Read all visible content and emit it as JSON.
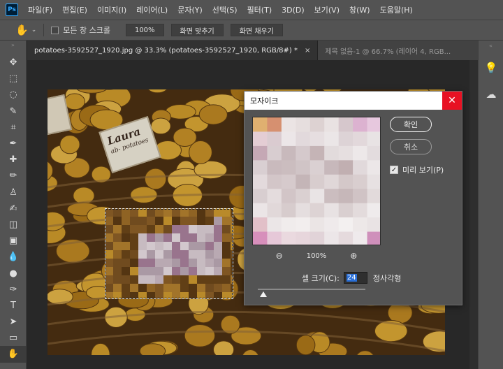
{
  "menubar": {
    "logo": "Ps",
    "items": [
      "파일(F)",
      "편집(E)",
      "이미지(I)",
      "레이어(L)",
      "문자(Y)",
      "선택(S)",
      "필터(T)",
      "3D(D)",
      "보기(V)",
      "창(W)",
      "도움말(H)"
    ]
  },
  "options": {
    "scroll_all_label": "모든 창 스크롤",
    "zoom_value": "100%",
    "fit_screen": "화면 맞추기",
    "fill_screen": "화면 채우기"
  },
  "tabs": [
    {
      "label": "potatoes-3592527_1920.jpg @ 33.3% (potatoes-3592527_1920, RGB/8#) *",
      "close": "×"
    },
    {
      "label": "제목 없음-1 @ 66.7% (레이어 4, RGB..."
    }
  ],
  "toolbar": {
    "icons": [
      "move-icon",
      "marquee-icon",
      "lasso-icon",
      "quick-select-icon",
      "crop-icon",
      "eyedropper-icon",
      "healing-icon",
      "brush-icon",
      "stamp-icon",
      "history-brush-icon",
      "eraser-icon",
      "gradient-icon",
      "blur-icon",
      "dodge-icon",
      "pen-icon",
      "type-icon",
      "path-select-icon",
      "shape-icon",
      "hand-icon"
    ],
    "glyphs": [
      "✥",
      "⬚",
      "◌",
      "✎",
      "⌗",
      "✒",
      "✚",
      "✏",
      "♙",
      "✍",
      "◫",
      "▣",
      "💧",
      "●",
      "✑",
      "T",
      "➤",
      "▭",
      "✋"
    ]
  },
  "canvas": {
    "tag_title": "Laura",
    "tag_sub": "ab- potatoes"
  },
  "dialog": {
    "title": "모자이크",
    "close": "✕",
    "ok": "확인",
    "cancel": "취소",
    "preview_label": "미리 보기(P)",
    "preview_checked": true,
    "zoom_level": "100%",
    "cell_label": "셀 크기(C):",
    "cell_value": "24",
    "cell_unit": "정사각형",
    "slider_fraction": 0.05,
    "preview_grid": [
      [
        "#e0b070",
        "#d69070",
        "#ebe4e4",
        "#e6dede",
        "#ddd2d2",
        "#e9e2e2",
        "#d6c7cc",
        "#dcb2d0",
        "#e7c8de"
      ],
      [
        "#e4cdd4",
        "#dacbd0",
        "#ece6e8",
        "#e2d9dc",
        "#e6dee0",
        "#ebe6e7",
        "#ddd3d6",
        "#e2d8db",
        "#e8e3e4"
      ],
      [
        "#c5a8b5",
        "#d8cdd0",
        "#c8b9bc",
        "#d5c9cc",
        "#c5b4b6",
        "#e2dbdc",
        "#e6dfe0",
        "#ede8e9",
        "#e3dcde"
      ],
      [
        "#d9cfd2",
        "#c9babd",
        "#cbbdbf",
        "#d0c4c6",
        "#dad0d2",
        "#c7b8bb",
        "#c1afb1",
        "#e1d9db",
        "#ece7e8"
      ],
      [
        "#e3dadc",
        "#d3c6c8",
        "#d6cacc",
        "#c4b5b7",
        "#d8cdce",
        "#e0d7d8",
        "#d4c8c9",
        "#d9cecf",
        "#e7e1e2"
      ],
      [
        "#d8ced0",
        "#e4dcdd",
        "#d2c5c7",
        "#dad0d1",
        "#e9e4e5",
        "#cbbdbf",
        "#c6b7b9",
        "#d0c3c5",
        "#e2dadb"
      ],
      [
        "#ebe5e6",
        "#e1d8d9",
        "#d7cccd",
        "#e5dedf",
        "#ddd3d4",
        "#e8e2e3",
        "#d9cfd0",
        "#e3dbdc",
        "#efebec"
      ],
      [
        "#e2c0c8",
        "#ebe6e7",
        "#f0ecec",
        "#f2eeee",
        "#ebe5e5",
        "#efeaeb",
        "#f3f0f0",
        "#ede8e8",
        "#e9e3e4"
      ],
      [
        "#d78fbb",
        "#e6c8d8",
        "#ead9df",
        "#e7d6dc",
        "#e1d3d8",
        "#ece6e8",
        "#e5dadd",
        "#efeaec",
        "#cf90bb"
      ]
    ]
  },
  "colors": {
    "accent": "#31a8ff",
    "close_red": "#e81123",
    "panel": "#535353",
    "workspace": "#282828"
  }
}
